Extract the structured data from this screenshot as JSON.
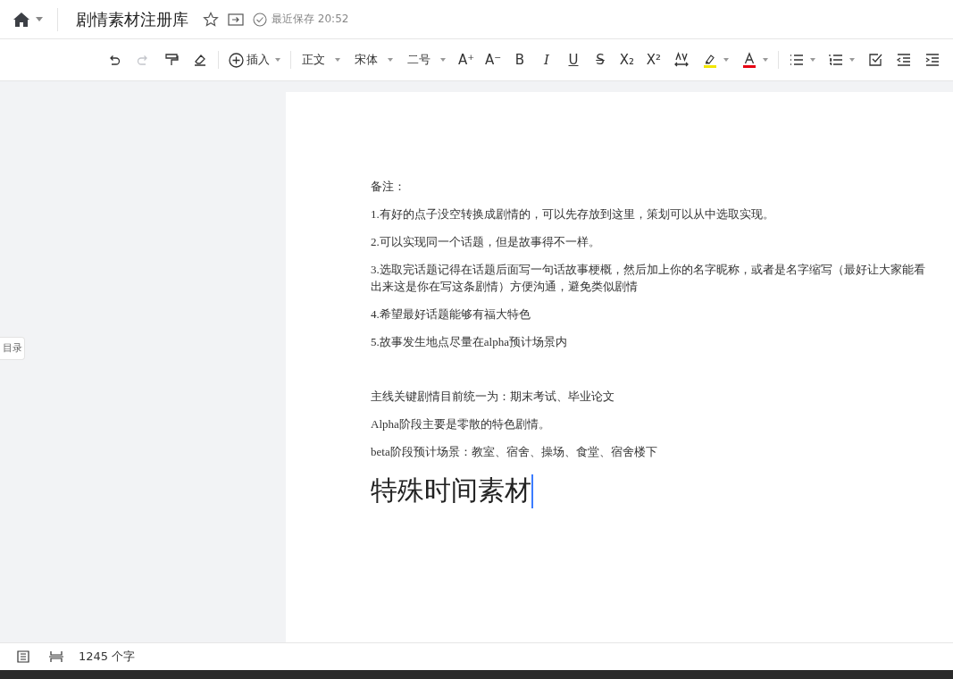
{
  "topbar": {
    "title": "剧情素材注册库",
    "save_status": "最近保存 20:52"
  },
  "toolbar": [
    {
      "kind": "icon",
      "disabled": false
    },
    {
      "kind": "icon",
      "disabled": true
    },
    {
      "kind": "icon"
    },
    {
      "kind": "icon"
    },
    {
      "kind": "separator"
    },
    {
      "kind": "insert",
      "label": "插入"
    },
    {
      "kind": "separator"
    },
    {
      "kind": "dropdown",
      "label": "正文"
    },
    {
      "kind": "dropdown",
      "label": "宋体"
    },
    {
      "kind": "dropdown",
      "label": "二号"
    },
    {
      "kind": "glyph",
      "label": "A⁺"
    },
    {
      "kind": "glyph",
      "label": "A⁻"
    },
    {
      "kind": "glyph",
      "label": "B"
    },
    {
      "kind": "glyph",
      "label": "I"
    },
    {
      "kind": "glyph",
      "label": "U"
    },
    {
      "kind": "glyph",
      "label": "S"
    },
    {
      "kind": "glyph",
      "label": "X₂"
    },
    {
      "kind": "glyph",
      "label": "X²"
    },
    {
      "kind": "icon"
    },
    {
      "kind": "color",
      "color": "#f2e600"
    },
    {
      "kind": "color",
      "color": "#e60012"
    },
    {
      "kind": "separator"
    },
    {
      "kind": "icon"
    },
    {
      "kind": "icon"
    },
    {
      "kind": "icon"
    },
    {
      "kind": "icon"
    },
    {
      "kind": "icon"
    }
  ],
  "toc_tab": "目录",
  "document": [
    {
      "kind": "para",
      "text": "备注："
    },
    {
      "kind": "para",
      "text": "1.有好的点子没空转换成剧情的，可以先存放到这里，策划可以从中选取实现。"
    },
    {
      "kind": "para",
      "text": "2.可以实现同一个话题，但是故事得不一样。"
    },
    {
      "kind": "para",
      "text": "3.选取完话题记得在话题后面写一句话故事梗概，然后加上你的名字昵称，或者是名字缩写（最好让大家能看出来这是你在写这条剧情）方便沟通，避免类似剧情"
    },
    {
      "kind": "para",
      "text": "4.希望最好话题能够有福大特色"
    },
    {
      "kind": "para",
      "text": "5.故事发生地点尽量在alpha预计场景内"
    },
    {
      "kind": "blank"
    },
    {
      "kind": "para",
      "text": "主线关键剧情目前统一为：期末考试、毕业论文"
    },
    {
      "kind": "para",
      "text": "Alpha阶段主要是零散的特色剧情。"
    },
    {
      "kind": "para",
      "text": "beta阶段预计场景：教室、宿舍、操场、食堂、宿舍楼下"
    },
    {
      "kind": "heading",
      "text": "特殊时间素材"
    }
  ],
  "status_bar": {
    "word_count": "1245 个字"
  }
}
